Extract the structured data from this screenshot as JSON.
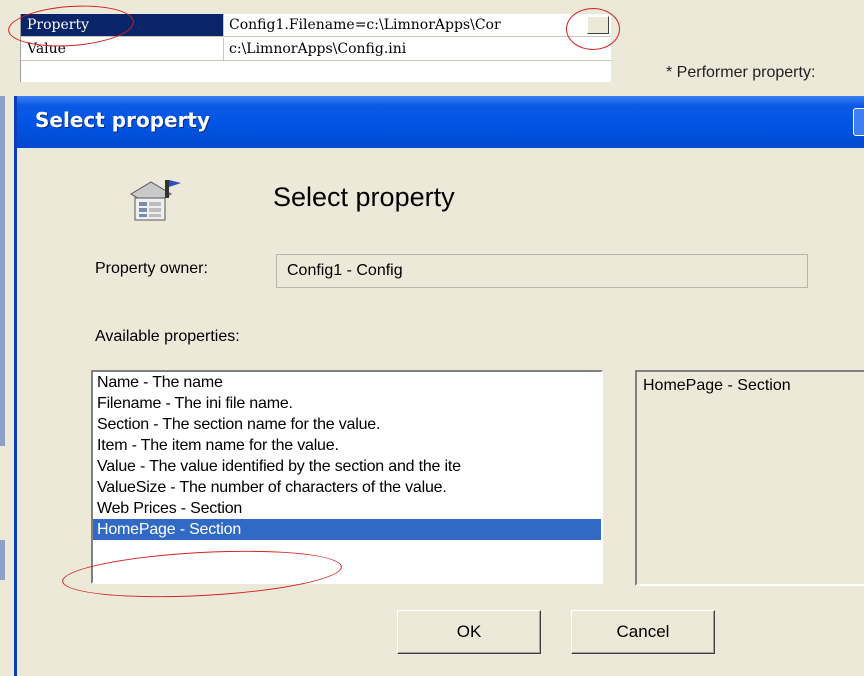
{
  "property_grid": {
    "rows": [
      {
        "name": "Property",
        "value": "Config1.Filename=c:\\LimnorApps\\Cor"
      },
      {
        "name": "Value",
        "value": "c:\\LimnorApps\\Config.ini"
      }
    ],
    "ellipsis_button": "",
    "performer_note": "* Performer property:"
  },
  "dialog": {
    "title": "Select property",
    "heading": "Select property",
    "icon": "property-sheet-icon",
    "owner_label": "Property owner:",
    "owner_value": "Config1 - Config",
    "available_label": "Available properties:",
    "properties": [
      "Name - The name",
      "Filename - The ini file name.",
      "Section - The section name for the value.",
      "Item - The item name for the value.",
      "Value - The value identified by the section and the ite",
      "ValueSize - The number of characters of the value.",
      "Web Prices - Section",
      "HomePage - Section"
    ],
    "selected_index": 7,
    "selected_description": "HomePage - Section",
    "ok_label": "OK",
    "cancel_label": "Cancel"
  },
  "colors": {
    "highlight": "#316ac5",
    "titlebar": "#0054e3",
    "annotation": "#d42020"
  }
}
